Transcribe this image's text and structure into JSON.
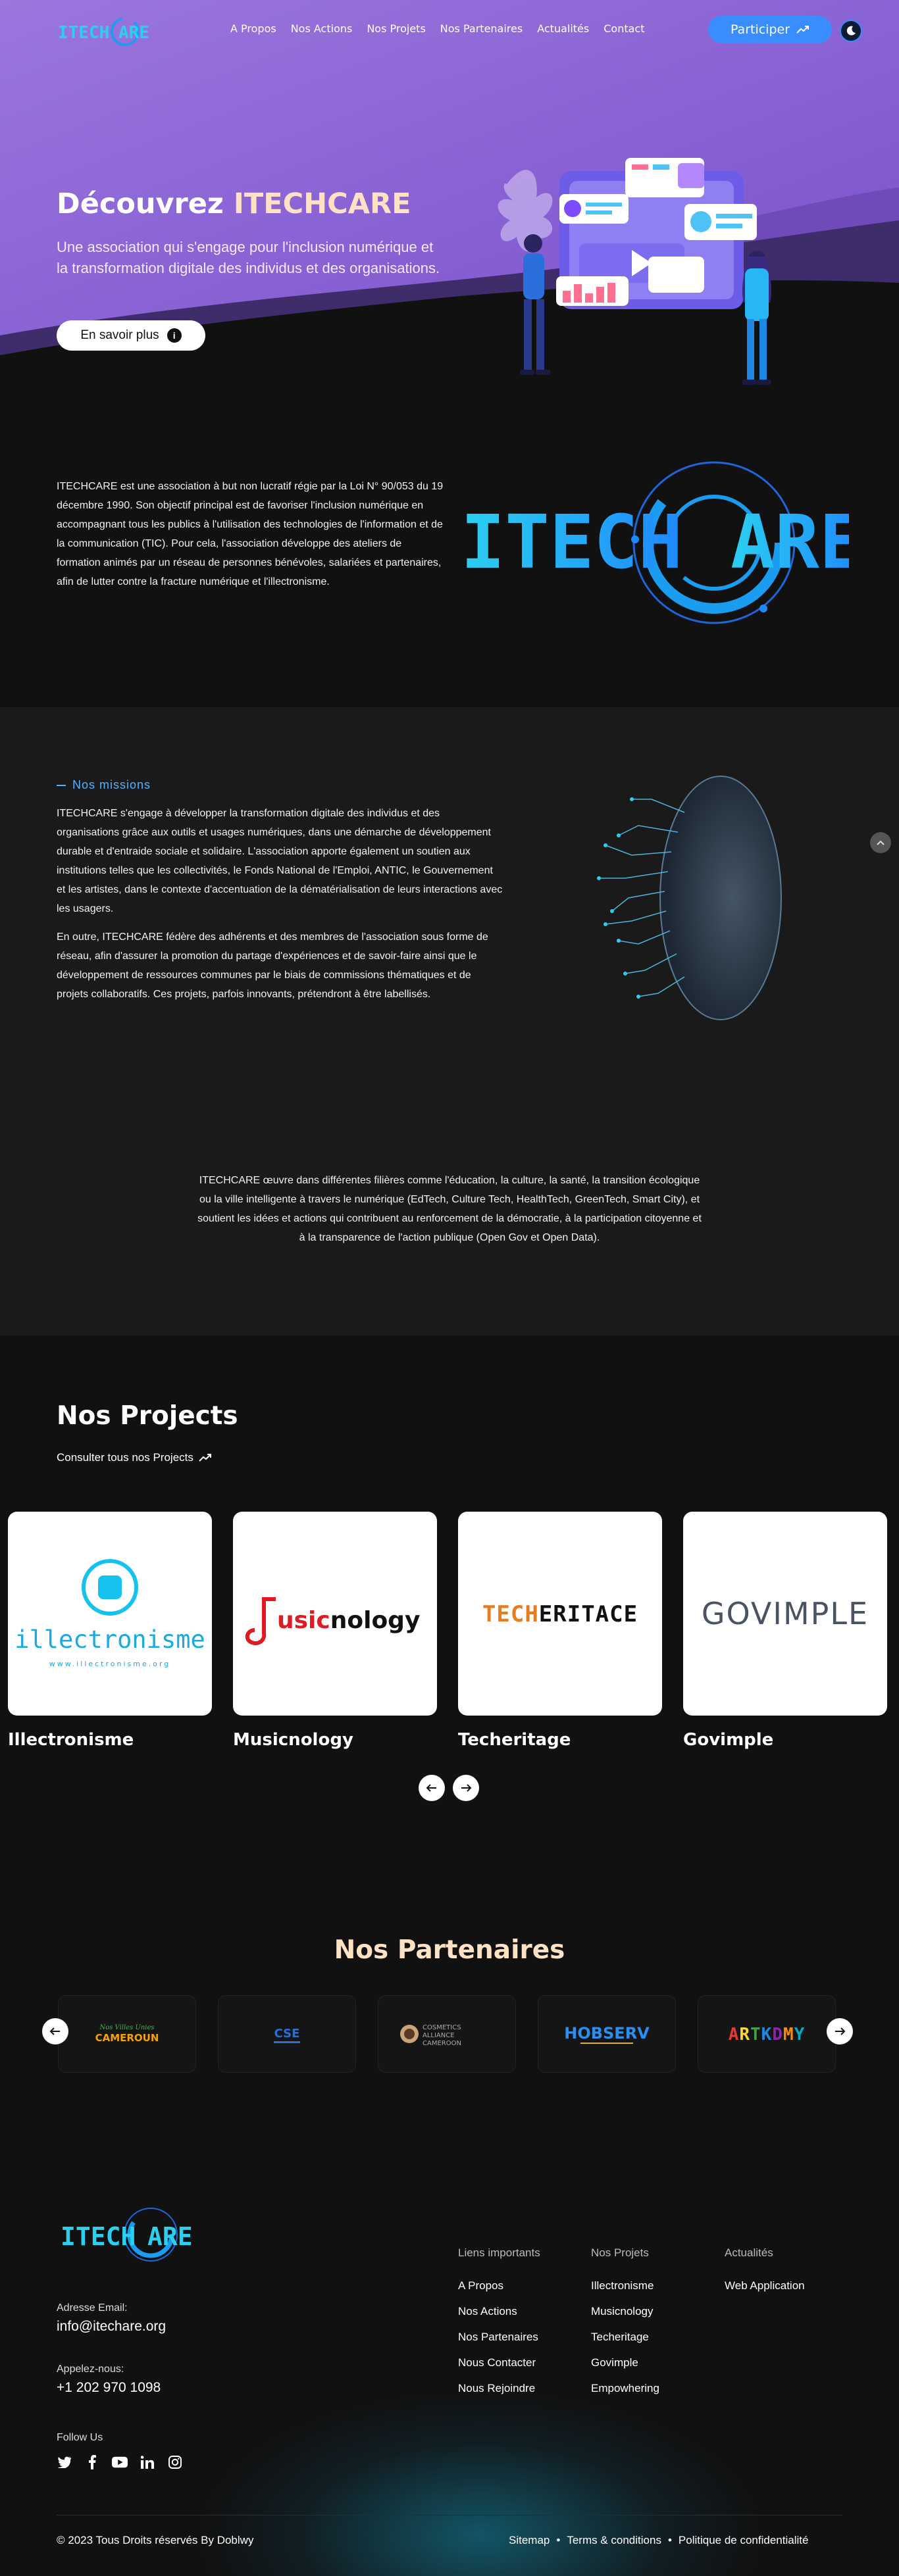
{
  "nav": {
    "logo": "ITECHCARE",
    "items": [
      "A Propos",
      "Nos Actions",
      "Nos Projets",
      "Nos Partenaires",
      "Actualités",
      "Contact"
    ],
    "cta": "Participer"
  },
  "hero": {
    "title_prefix": "Découvrez ",
    "title_brand": "ITECHCARE",
    "subtitle": "Une association qui s'engage pour l'inclusion numérique et la transformation digitale des individus et des organisations.",
    "button": "En savoir plus"
  },
  "about": {
    "text": "ITECHCARE est une association à but non lucratif régie par la Loi N° 90/053 du 19 décembre 1990. Son objectif principal est de favoriser l'inclusion numérique en accompagnant tous les publics à l'utilisation des technologies de l'information et de la communication (TIC). Pour cela, l'association développe des ateliers de formation animés par un réseau de personnes bénévoles, salariées et partenaires, afin de lutter contre la fracture numérique et l'illectronisme.",
    "logo": "ITECHCARE"
  },
  "missions": {
    "tag": "Nos missions",
    "p1": "ITECHCARE s'engage à développer la transformation digitale des individus et des organisations grâce aux outils et usages numériques, dans une démarche de développement durable et d'entraide sociale et solidaire. L'association apporte également un soutien aux institutions telles que les collectivités, le Fonds National de l'Emploi, ANTIC, le Gouvernement et les artistes, dans le contexte d'accentuation de la dématérialisation de leurs interactions avec les usagers.",
    "p2": "En outre, ITECHCARE fédère des adhérents et des membres de l'association sous forme de réseau, afin d'assurer la promotion du partage d'expériences et de savoir-faire ainsi que le développement de ressources communes par le biais de commissions thématiques et de projets collaboratifs. Ces projets, parfois innovants, prétendront à être labellisés.",
    "center": "ITECHCARE œuvre dans différentes filières comme l'éducation, la culture, la santé, la transition écologique ou la ville intelligente à travers le numérique (EdTech, Culture Tech, HealthTech, GreenTech, Smart City), et soutient les idées et actions qui contribuent au renforcement de la démocratie, à la participation citoyenne et à la transparence de l'action publique (Open Gov et Open Data)."
  },
  "projects": {
    "title": "Nos Projects",
    "link": "Consulter tous nos Projects",
    "cards": [
      {
        "name": "Illectronisme",
        "logo": "illectronisme",
        "logo_sub": "www.illectronisme.org"
      },
      {
        "name": "Musicnology",
        "logo": "Musicnology"
      },
      {
        "name": "Techeritage",
        "logo": "TECHERITACE"
      },
      {
        "name": "Govimple",
        "logo": "GOVIMPLE"
      }
    ]
  },
  "partners": {
    "title": "Nos Partenaires",
    "logos": [
      "Nos Villes Unies CAMEROUN",
      "CSE",
      "COSMETICS ALLIANCE CAMEROON",
      "HOBSERV",
      "ARTKDMY"
    ]
  },
  "footer": {
    "logo": "ITECHCARE",
    "email_label": "Adresse Email:",
    "email": "info@itechare.org",
    "phone_label": "Appelez-nous:",
    "phone": "+1 202 970 1098",
    "follow_label": "Follow Us",
    "col1": {
      "title": "Liens importants",
      "items": [
        "A Propos",
        "Nos Actions",
        "Nos Partenaires",
        "Nous Contacter",
        "Nous Rejoindre"
      ]
    },
    "col2": {
      "title": "Nos Projets",
      "items": [
        "Illectronisme",
        "Musicnology",
        "Techeritage",
        "Govimple",
        "Empowhering"
      ]
    },
    "col3": {
      "title": "Actualités",
      "items": [
        "Web Application"
      ]
    },
    "copyright": "© 2023 Tous Droits réservés By Doblwy",
    "legal": [
      "Sitemap",
      "Terms & conditions",
      "Politique de confidentialité"
    ],
    "legal_sep": "•"
  },
  "colors": {
    "accent": "#3a8dff",
    "hero_purple": "#8a63d2",
    "cyan": "#2bd0f0",
    "peach": "#ffe1c4"
  },
  "icons": [
    "trend-arrow-icon",
    "moon-icon",
    "info-icon",
    "chevron-up-icon",
    "arrow-left-icon",
    "arrow-right-icon",
    "twitter-icon",
    "facebook-icon",
    "youtube-icon",
    "linkedin-icon",
    "instagram-icon"
  ]
}
